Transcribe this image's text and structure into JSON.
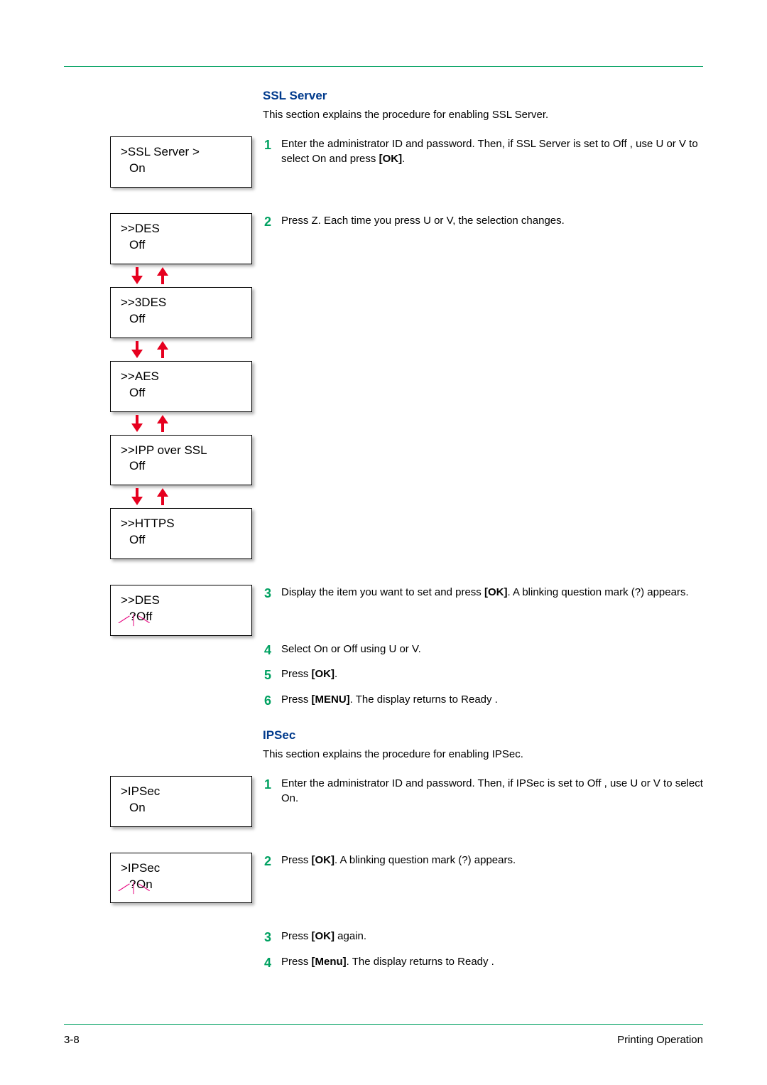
{
  "footer": {
    "page": "3-8",
    "section": "Printing Operation"
  },
  "ssl": {
    "heading": "SSL Server",
    "intro": "This section explains the procedure for enabling SSL Server.",
    "lcd_main": {
      "l1": ">SSL Server   >",
      "l2": "On"
    },
    "lcd_des": {
      "l1": ">>DES",
      "l2": "Off"
    },
    "lcd_3des": {
      "l1": ">>3DES",
      "l2": "Off"
    },
    "lcd_aes": {
      "l1": ">>AES",
      "l2": "Off"
    },
    "lcd_ipp": {
      "l1": ">>IPP over SSL",
      "l2": "Off"
    },
    "lcd_https": {
      "l1": ">>HTTPS",
      "l2": "Off"
    },
    "lcd_des_q": {
      "l1": ">>DES",
      "q": "?",
      "l2": "Off"
    },
    "step1a": "Enter the administrator ID and password. Then, if SSL Server    is set to Off , use  U or  V to select On and press ",
    "step1b": "[OK]",
    "step1c": ".",
    "step2": "Press  Z. Each time you press  U or  V, the selection changes.",
    "step3a": "Display the item you want to set and press ",
    "step3b": "[OK]",
    "step3c": ". A blinking question mark (?) appears.",
    "step4": "Select On or Off   using  U or  V.",
    "step5a": "Press ",
    "step5b": "[OK]",
    "step5c": ".",
    "step6a": "Press ",
    "step6b": "[MENU]",
    "step6c": ". The display returns to Ready ."
  },
  "ipsec": {
    "heading": "IPSec",
    "intro": "This section explains the procedure for enabling IPSec.",
    "lcd_main": {
      "l1": ">IPSec",
      "l2": "On"
    },
    "lcd_main_q": {
      "l1": ">IPSec",
      "q": "?",
      "l2": "On"
    },
    "step1": "Enter the administrator ID and password. Then, if IPSec  is set to Off , use  U or  V to select On.",
    "step2a": "Press ",
    "step2b": "[OK]",
    "step2c": ". A blinking question mark (?) appears.",
    "step3a": "Press ",
    "step3b": "[OK]",
    "step3c": " again.",
    "step4a": "Press ",
    "step4b": "[Menu]",
    "step4c": ". The display returns to Ready ."
  }
}
